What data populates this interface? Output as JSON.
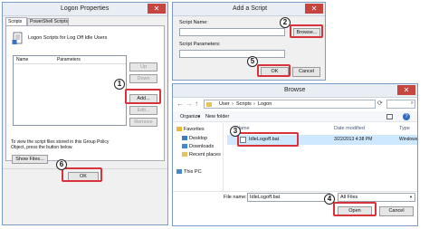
{
  "logon_dialog": {
    "title": "Logon Properties",
    "tabs": [
      "Scripts",
      "PowerShell Scripts"
    ],
    "description": "Logon Scripts for Log Off Idle Users",
    "columns": [
      "Name",
      "Parameters"
    ],
    "buttons": {
      "up": "Up",
      "down": "Down",
      "add": "Add...",
      "edit": "Edit...",
      "remove": "Remove",
      "show_files": "Show Files...",
      "ok": "OK"
    },
    "footer_text": "To view the script files stored in this Group Policy Object, press the button below."
  },
  "add_script": {
    "title": "Add a Script",
    "script_name_label": "Script Name:",
    "script_name_value": "",
    "script_params_label": "Script Parameters:",
    "script_params_value": "",
    "browse": "Browse...",
    "ok": "OK",
    "cancel": "Cancel"
  },
  "browse_dialog": {
    "title": "Browse",
    "breadcrumb": [
      "User",
      "Scripts",
      "Logon"
    ],
    "toolbar": {
      "organize": "Organize",
      "new_folder": "New folder"
    },
    "columns": {
      "name": "Name",
      "date": "Date modified",
      "type": "Type"
    },
    "nav": [
      "Favorites",
      "Desktop",
      "Downloads",
      "Recent places",
      "This PC"
    ],
    "file": {
      "name": "IdleLogoff.bat",
      "date": "3/22/2013 4:38 PM",
      "type": "Windows"
    },
    "file_name_label": "File name:",
    "file_name_value": "IdleLogoff.bat",
    "filter": "All Files",
    "open": "Open",
    "cancel": "Cancel"
  },
  "steps": [
    "1",
    "2",
    "3",
    "4",
    "5",
    "6"
  ],
  "colors": {
    "highlight": "#d8323a",
    "window_border": "#7a9cc6",
    "close": "#c7453f",
    "selection": "#cde8ff"
  }
}
